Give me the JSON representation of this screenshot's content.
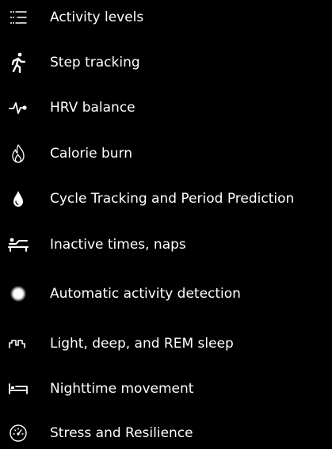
{
  "features": [
    {
      "label": "Activity levels",
      "icon": "list-icon"
    },
    {
      "label": "Step tracking",
      "icon": "walking-person-icon"
    },
    {
      "label": "HRV balance",
      "icon": "heartbeat-pulse-icon"
    },
    {
      "label": "Calorie burn",
      "icon": "flame-icon"
    },
    {
      "label": "Cycle Tracking and Period Prediction",
      "icon": "droplet-icon"
    },
    {
      "label": "Inactive times, naps",
      "icon": "reclining-person-icon"
    },
    {
      "label": "Automatic activity detection",
      "icon": "glowing-dot-icon"
    },
    {
      "label": "Light, deep, and REM sleep",
      "icon": "sleep-stages-icon"
    },
    {
      "label": "Nighttime movement",
      "icon": "bed-icon"
    },
    {
      "label": "Stress and Resilience",
      "icon": "gauge-icon"
    }
  ],
  "colors": {
    "background": "#000000",
    "text": "#ffffff",
    "icon": "#ffffff"
  }
}
